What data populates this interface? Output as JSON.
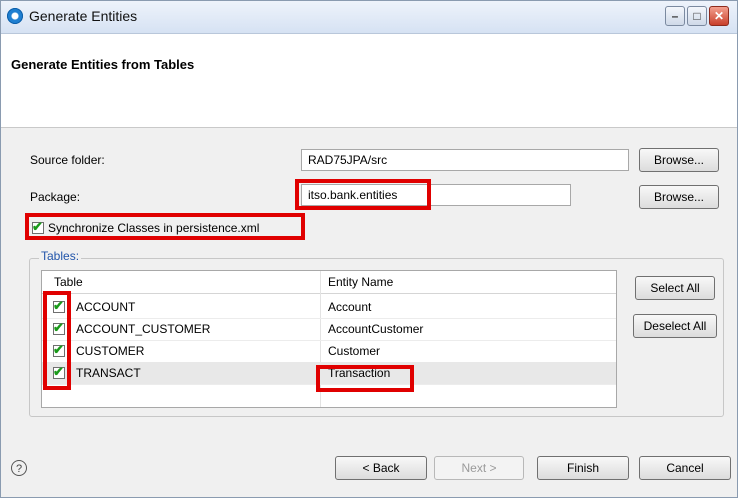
{
  "window": {
    "title": "Generate Entities",
    "min_icon": "minimize-icon",
    "max_icon": "maximize-icon",
    "close_icon": "close-icon"
  },
  "header": {
    "title": "Generate Entities from Tables"
  },
  "form": {
    "source_folder_label": "Source folder:",
    "source_folder_value": "RAD75JPA/src",
    "package_label": "Package:",
    "package_value": "itso.bank.entities",
    "browse_label": "Browse...",
    "sync_label": "Synchronize Classes in persistence.xml",
    "sync_checked": true
  },
  "tables": {
    "group_label": "Tables:",
    "columns": [
      "Table",
      "Entity Name"
    ],
    "rows": [
      {
        "table": "ACCOUNT",
        "entity": "Account",
        "checked": true
      },
      {
        "table": "ACCOUNT_CUSTOMER",
        "entity": "AccountCustomer",
        "checked": true
      },
      {
        "table": "CUSTOMER",
        "entity": "Customer",
        "checked": true
      },
      {
        "table": "TRANSACT",
        "entity": "Transaction",
        "checked": true
      }
    ],
    "select_all": "Select All",
    "deselect_all": "Deselect All"
  },
  "footer": {
    "help_icon": "help-icon",
    "back": "< Back",
    "next": "Next >",
    "finish": "Finish",
    "cancel": "Cancel"
  },
  "colors": {
    "highlight": "#e00000",
    "check": "#1a9a1a",
    "group_label": "#2255aa"
  }
}
